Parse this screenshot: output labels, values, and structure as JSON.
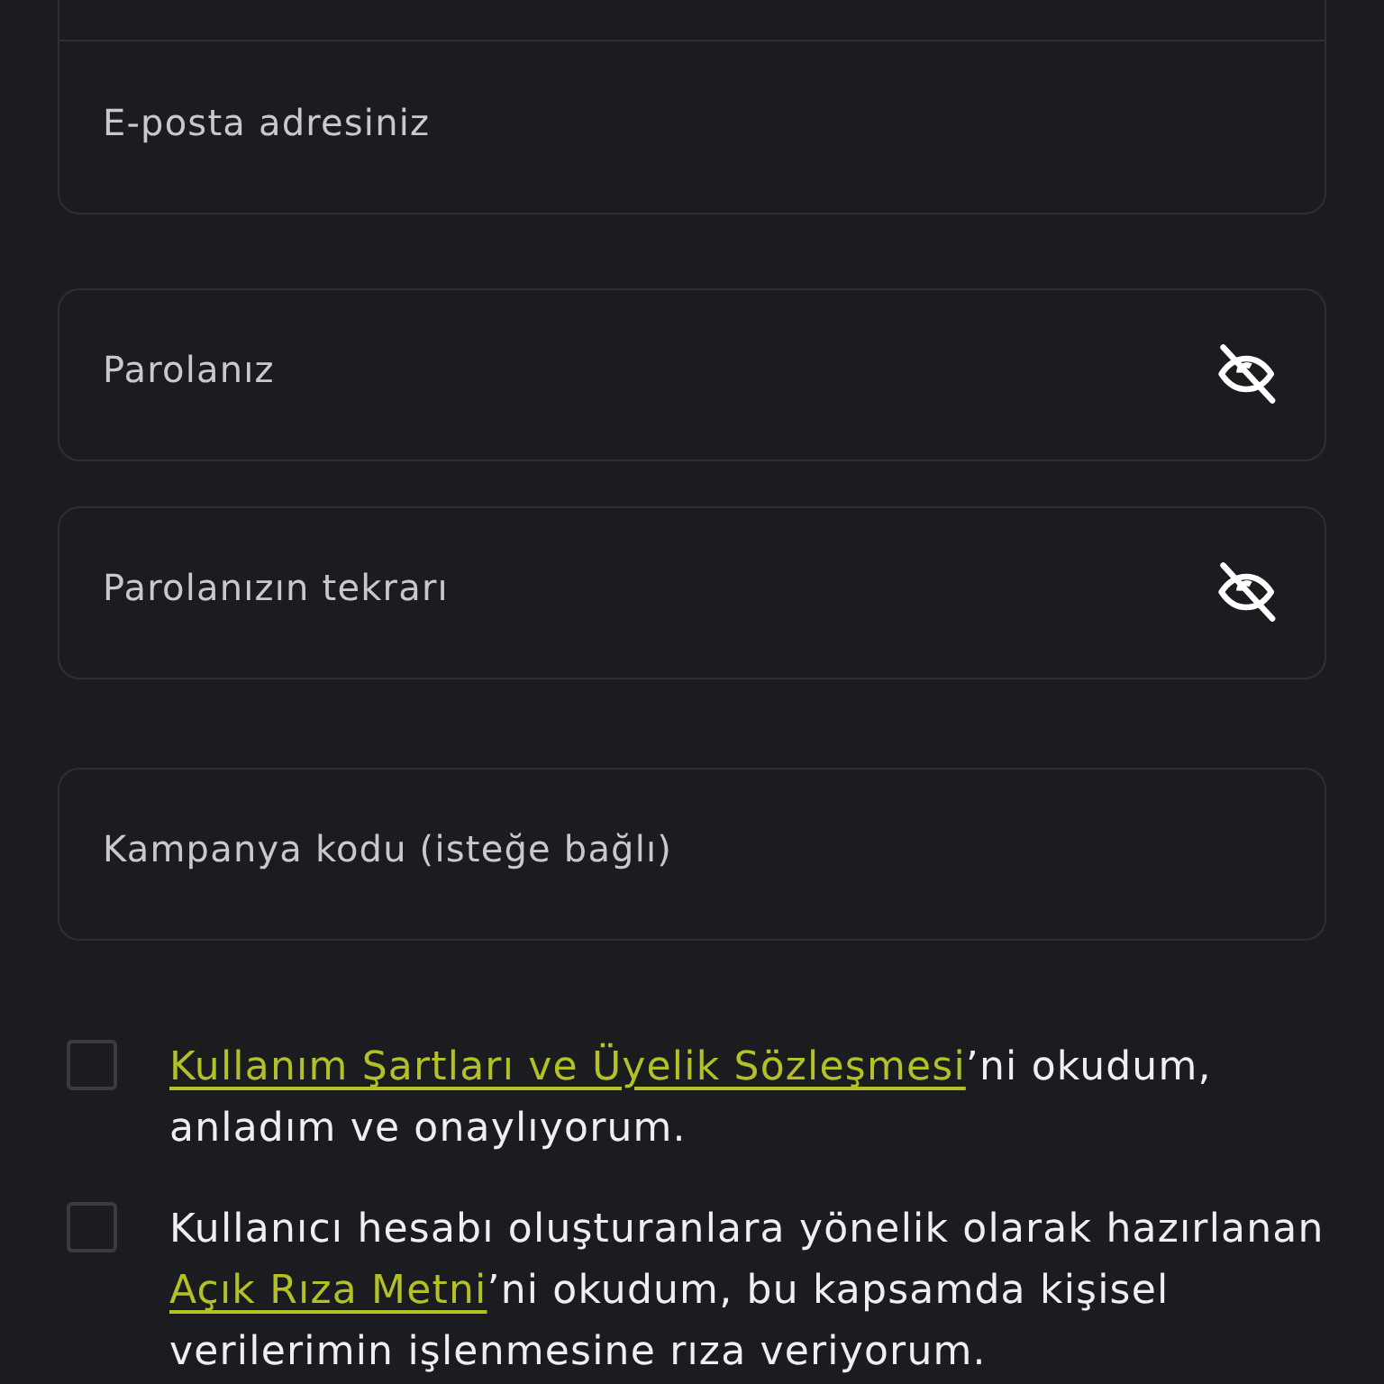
{
  "form": {
    "fields": [
      {
        "kind": "text"
      },
      {
        "kind": "text",
        "placeholder": "E-posta adresiniz"
      },
      {
        "kind": "password",
        "placeholder": "Parolanız",
        "password_visible": false
      },
      {
        "kind": "password",
        "placeholder": "Parolanızın tekrarı",
        "password_visible": false
      },
      {
        "kind": "text",
        "placeholder": "Kampanya kodu (isteğe bağlı)"
      }
    ],
    "consents": [
      {
        "checked": false,
        "link": "Kullanım Şartları ve Üyelik Sözleşmesi",
        "after": "’ni okudum, anladım ve onaylıyorum."
      },
      {
        "checked": false,
        "before": "Kullanıcı hesabı oluşturanlara yönelik olarak hazırlanan ",
        "link": "Açık Rıza Metni",
        "after": "’ni okudum, bu kapsamda kişisel verilerimin işlenmesine rıza veriyorum."
      }
    ]
  }
}
